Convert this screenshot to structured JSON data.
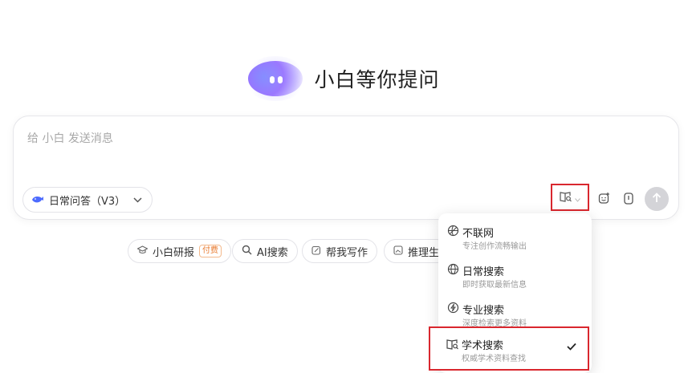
{
  "hero": {
    "title": "小白等你提问"
  },
  "composer": {
    "placeholder": "给 小白 发送消息",
    "mode_label": "日常问答（V3）"
  },
  "chips": [
    {
      "label": "小白研报",
      "badge": "付费",
      "icon": "graduation-cap-icon"
    },
    {
      "label": "AI搜索",
      "icon": "search-icon"
    },
    {
      "label": "帮我写作",
      "icon": "edit-icon"
    },
    {
      "label": "推理生",
      "icon": "image-icon"
    }
  ],
  "search_menu": {
    "options": [
      {
        "title": "不联网",
        "desc": "专注创作流畅输出",
        "icon": "no-network-icon",
        "selected": false
      },
      {
        "title": "日常搜索",
        "desc": "即时获取最新信息",
        "icon": "globe-icon",
        "selected": false
      },
      {
        "title": "专业搜索",
        "desc": "深度检索更多资料",
        "icon": "bolt-icon",
        "selected": false
      },
      {
        "title": "学术搜索",
        "desc": "权威学术资料查找",
        "icon": "book-icon",
        "selected": true
      }
    ]
  },
  "colors": {
    "highlight_border": "#d9272e",
    "send_disabled": "#d4d4d8",
    "badge": "#e8772a"
  }
}
